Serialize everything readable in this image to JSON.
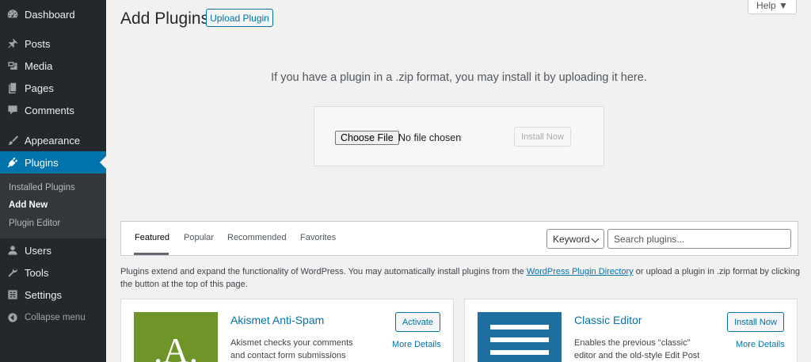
{
  "sidebar": {
    "items": [
      {
        "label": "Dashboard",
        "icon": "dashboard-icon"
      },
      {
        "label": "Posts",
        "icon": "pushpin-icon"
      },
      {
        "label": "Media",
        "icon": "media-icon"
      },
      {
        "label": "Pages",
        "icon": "pages-icon"
      },
      {
        "label": "Comments",
        "icon": "comment-icon"
      },
      {
        "label": "Appearance",
        "icon": "brush-icon"
      },
      {
        "label": "Plugins",
        "icon": "plugin-icon"
      },
      {
        "label": "Users",
        "icon": "users-icon"
      },
      {
        "label": "Tools",
        "icon": "wrench-icon"
      },
      {
        "label": "Settings",
        "icon": "settings-icon"
      },
      {
        "label": "Collapse menu",
        "icon": "collapse-icon"
      }
    ],
    "submenu": [
      "Installed Plugins",
      "Add New",
      "Plugin Editor"
    ]
  },
  "header": {
    "title": "Add Plugins",
    "upload_button": "Upload Plugin",
    "help": "Help ▼"
  },
  "upload": {
    "message": "If you have a plugin in a .zip format, you may install it by uploading it here.",
    "choose_file": "Choose File",
    "file_status": "No file chosen",
    "install_now": "Install Now"
  },
  "filter": {
    "tabs": [
      "Featured",
      "Popular",
      "Recommended",
      "Favorites"
    ],
    "select_value": "Keyword",
    "search_placeholder": "Search plugins..."
  },
  "intro": {
    "before": "Plugins extend and expand the functionality of WordPress. You may automatically install plugins from the ",
    "link": "WordPress Plugin Directory",
    "after": " or upload a plugin in .zip format by clicking the button at the top of this page."
  },
  "cards": [
    {
      "title": "Akismet Anti-Spam",
      "description": "Akismet checks your comments and contact form submissions",
      "action": "Activate",
      "more": "More Details",
      "thumb_color": "#6f9428",
      "thumb_letter": ".A."
    },
    {
      "title": "Classic Editor",
      "description": "Enables the previous \"classic\" editor and the old-style Edit Post",
      "action": "Install Now",
      "more": "More Details",
      "thumb_color": "#1e6f9e"
    }
  ],
  "colors": {
    "sidebar_bg": "#23282d",
    "accent": "#0073aa",
    "submenu_bg": "#32373c"
  }
}
